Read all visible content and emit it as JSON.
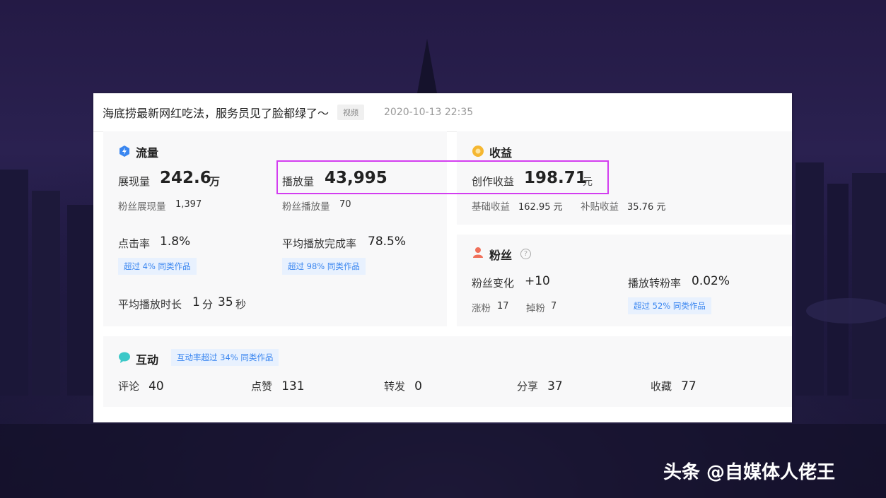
{
  "header": {
    "video_title": "海底捞最新网红吃法，服务员见了脸都绿了～",
    "tag": "视频",
    "publish_time": "2020-10-13 22:35"
  },
  "traffic": {
    "title": "流量",
    "impressions_label": "展现量",
    "impressions_value": "242.6",
    "impressions_unit": "万",
    "fan_impressions_label": "粉丝展现量",
    "fan_impressions_value": "1,397",
    "plays_label": "播放量",
    "plays_value": "43,995",
    "fan_plays_label": "粉丝播放量",
    "fan_plays_value": "70",
    "ctr_label": "点击率",
    "ctr_value": "1.8%",
    "ctr_badge": "超过 4% 同类作品",
    "completion_label": "平均播放完成率",
    "completion_value": "78.5%",
    "completion_badge": "超过 98% 同类作品",
    "avg_duration_label": "平均播放时长",
    "avg_duration_min": "1",
    "avg_duration_min_unit": "分",
    "avg_duration_sec": "35",
    "avg_duration_sec_unit": "秒"
  },
  "income": {
    "title": "收益",
    "creation_label": "创作收益",
    "creation_value": "198.71",
    "creation_unit": "元",
    "base_label": "基础收益",
    "base_value": "162.95 元",
    "subsidy_label": "补贴收益",
    "subsidy_value": "35.76 元"
  },
  "fans": {
    "title": "粉丝",
    "help_glyph": "?",
    "change_label": "粉丝变化",
    "change_value": "+10",
    "gain_label": "涨粉",
    "gain_value": "17",
    "loss_label": "掉粉",
    "loss_value": "7",
    "conv_label": "播放转粉率",
    "conv_value": "0.02%",
    "conv_badge": "超过 52% 同类作品"
  },
  "interaction": {
    "title": "互动",
    "badge": "互动率超过 34% 同类作品",
    "metrics": [
      {
        "label": "评论",
        "value": "40"
      },
      {
        "label": "点赞",
        "value": "131"
      },
      {
        "label": "转发",
        "value": "0"
      },
      {
        "label": "分享",
        "value": "37"
      },
      {
        "label": "收藏",
        "value": "77"
      }
    ]
  },
  "watermark": "头条 @自媒体人佬王",
  "colors": {
    "accent_blue": "#3a86f0",
    "highlight": "#d33df0",
    "income_icon": "#f5b731",
    "fans_icon": "#f0705a",
    "interact_icon": "#3cc8c8"
  }
}
